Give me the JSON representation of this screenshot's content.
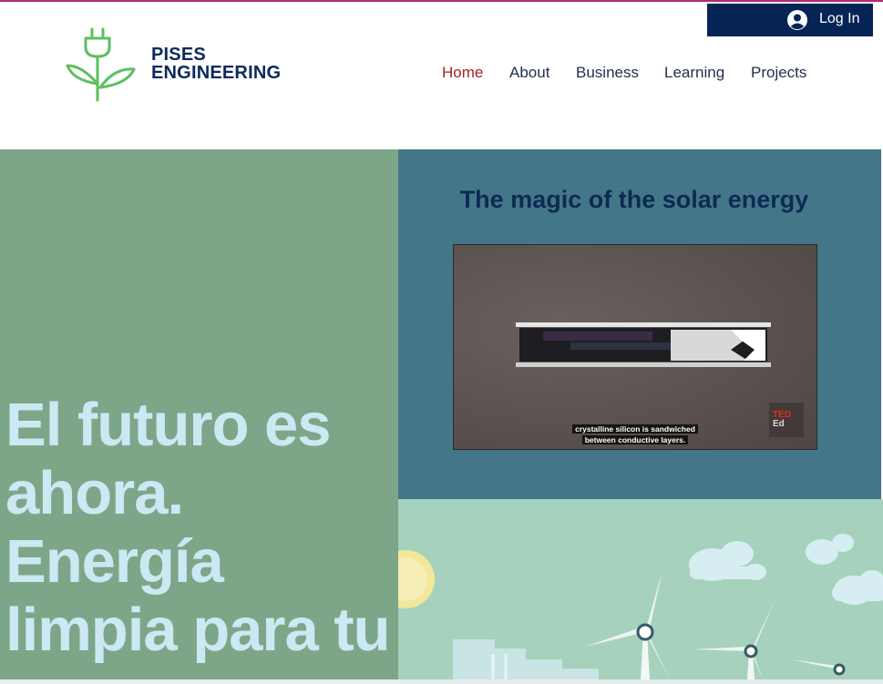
{
  "brand": {
    "name_line1": "PISES",
    "name_line2": "ENGINEERING",
    "logo_icon": "plug-plant-icon",
    "logo_color": "#5cbf5f"
  },
  "auth": {
    "login_label": "Log In",
    "icon": "user-circle-icon"
  },
  "nav": {
    "items": [
      {
        "label": "Home",
        "active": true
      },
      {
        "label": "About",
        "active": false
      },
      {
        "label": "Business",
        "active": false
      },
      {
        "label": "Learning",
        "active": false
      },
      {
        "label": "Projects",
        "active": false
      }
    ]
  },
  "hero": {
    "headline": "El futuro es ahora. Energía limpia para tu"
  },
  "video_section": {
    "title": "The magic of the solar energy",
    "caption_line1": "crystalline silicon is sandwiched",
    "caption_line2": "between conductive layers.",
    "badge_line1": "TED",
    "badge_line2": "Ed"
  },
  "colors": {
    "accent_top": "#b3287f",
    "login_bg": "#072456",
    "nav_active": "#a3241f",
    "hero_bg": "#7da689",
    "hero_text": "#cce8f3",
    "video_panel_bg": "#447689",
    "illus_bg": "#a6d1bd"
  }
}
